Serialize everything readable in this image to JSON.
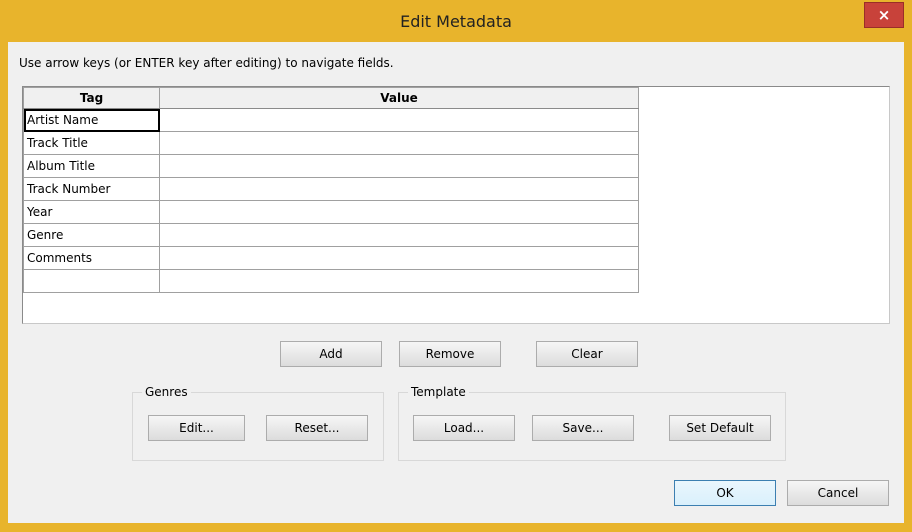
{
  "window": {
    "title": "Edit Metadata",
    "close_glyph": "×"
  },
  "hint": "Use arrow keys (or ENTER key after editing) to navigate fields.",
  "grid": {
    "headers": {
      "tag": "Tag",
      "value": "Value"
    },
    "rows": [
      {
        "tag": "Artist Name",
        "value": ""
      },
      {
        "tag": "Track Title",
        "value": ""
      },
      {
        "tag": "Album Title",
        "value": ""
      },
      {
        "tag": "Track Number",
        "value": ""
      },
      {
        "tag": "Year",
        "value": ""
      },
      {
        "tag": "Genre",
        "value": ""
      },
      {
        "tag": "Comments",
        "value": ""
      },
      {
        "tag": "",
        "value": ""
      }
    ]
  },
  "buttons": {
    "add": "Add",
    "remove": "Remove",
    "clear": "Clear",
    "ok": "OK",
    "cancel": "Cancel"
  },
  "genres": {
    "label": "Genres",
    "edit": "Edit...",
    "reset": "Reset..."
  },
  "template": {
    "label": "Template",
    "load": "Load...",
    "save": "Save...",
    "set_default": "Set Default"
  }
}
